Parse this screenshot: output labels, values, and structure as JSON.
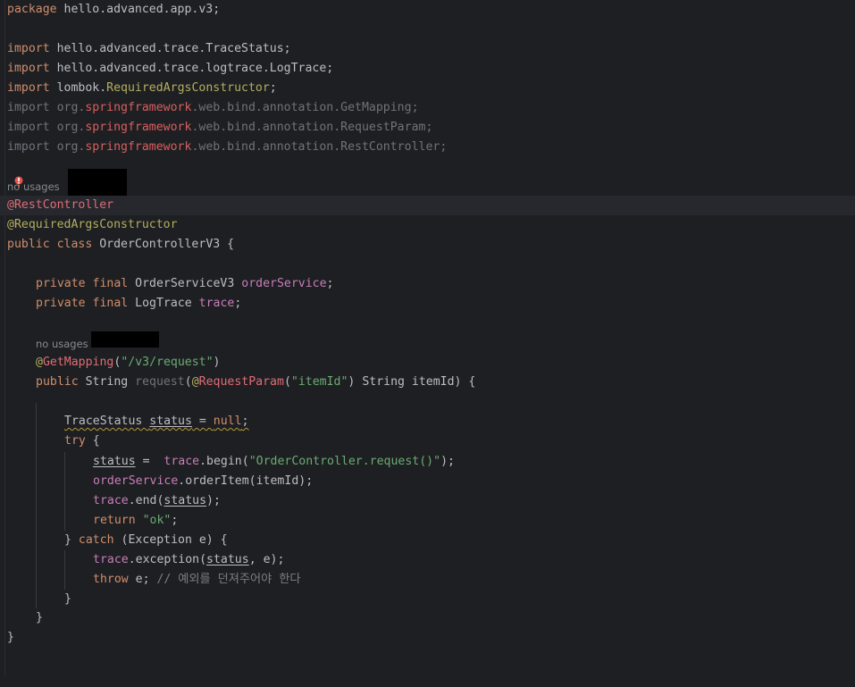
{
  "editor": {
    "lines": {
      "package_kw": "package",
      "package_name": " hello.advanced.app.v3;",
      "imp1_kw": "import",
      "imp1_rest": " hello.advanced.trace.TraceStatus;",
      "imp2_kw": "import",
      "imp2_rest": " hello.advanced.trace.logtrace.LogTrace;",
      "imp3_kw": "import",
      "imp3_pre": " lombok.",
      "imp3_ann": "RequiredArgsConstructor",
      "imp3_end": ";",
      "imp4_kw": "import",
      "imp4_pre": " org.",
      "imp4_spring": "springframework",
      "imp4_post": ".web.bind.annotation.GetMapping;",
      "imp5_kw": "import",
      "imp5_pre": " org.",
      "imp5_spring": "springframework",
      "imp5_post": ".web.bind.annotation.RequestParam;",
      "imp6_kw": "import",
      "imp6_pre": " org.",
      "imp6_spring": "springframework",
      "imp6_post": ".web.bind.annotation.RestController;",
      "class_hint": "no usages",
      "ann_restcontroller": "@RestController",
      "ann_required": "@RequiredArgsConstructor",
      "class_kw": "public class",
      "class_name": " OrderControllerV3 {",
      "f1_kw": "private final",
      "f1_type": " OrderServiceV3 ",
      "f1_name": "orderService",
      "f1_end": ";",
      "f2_kw": "private final",
      "f2_type": " LogTrace ",
      "f2_name": "trace",
      "f2_end": ";",
      "method_hint": "no usages",
      "gm_at": "@",
      "gm_name": "GetMapping",
      "gm_open": "(",
      "gm_str": "\"/v3/request\"",
      "gm_close": ")",
      "m_kw": "public",
      "m_type": " String ",
      "m_name": "request",
      "m_paren": "(",
      "m_ann_at": "@",
      "m_ann": "RequestParam",
      "m_ann_open": "(",
      "m_ann_str": "\"itemId\"",
      "m_ann_close": ")",
      "m_rest": " String itemId) {",
      "s1_type": "TraceStatus ",
      "s1_var": "status",
      "s1_eq": " = ",
      "s1_null": "null",
      "s1_end": ";",
      "try_kw": "try",
      "try_brace": " {",
      "b1_var": "status",
      "b1_eq": " =  ",
      "b1_field": "trace",
      "b1_call": ".begin(",
      "b1_str": "\"OrderController.request()\"",
      "b1_end": ");",
      "b2_field": "orderService",
      "b2_call": ".orderItem(itemId);",
      "b3_field": "trace",
      "b3_call": ".end(",
      "b3_var": "status",
      "b3_end": ");",
      "ret_kw": "return",
      "ret_sp": " ",
      "ret_str": "\"ok\"",
      "ret_end": ";",
      "catch_open": "} ",
      "catch_kw": "catch",
      "catch_rest": " (Exception e) {",
      "c1_field": "trace",
      "c1_call": ".exception(",
      "c1_var": "status",
      "c1_end": ", e);",
      "throw_kw": "throw",
      "throw_rest": " e; ",
      "throw_cmt": "// 예외를 던져주어야 한다",
      "close_catch": "}",
      "close_method": "}",
      "close_class": "}"
    },
    "colors": {
      "background": "#1e1f22",
      "keyword": "#cf8e6d",
      "annotation": "#b3ae60",
      "string": "#6aab73",
      "field": "#c77dbb",
      "comment": "#7a7e85",
      "error": "#e06c75"
    },
    "icons": {
      "error_marker": "error-icon"
    }
  }
}
